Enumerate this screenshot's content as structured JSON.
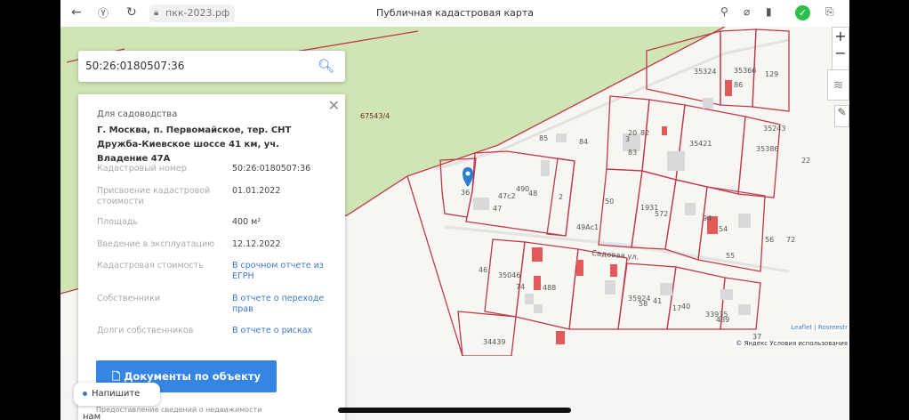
{
  "browser": {
    "url": "пкк-2023.рф",
    "title": "Публичная кадастровая карта"
  },
  "search": {
    "value": "50:26:0180507:36"
  },
  "panel": {
    "purpose": "Для садоводства",
    "address": "Г. Москва, п. Первомайское, тер. СНТ Дружба-Киевское шоссе 41 км, уч. Владение 47А",
    "rows": [
      {
        "key": "Кадастровый номер",
        "value": "50:26:0180507:36",
        "link": false
      },
      {
        "key": "Присвоение кадастровой стоимости",
        "value": "01.01.2022",
        "link": false
      },
      {
        "key": "Площадь",
        "value": "400 м²",
        "link": false
      },
      {
        "key": "Введение в эксплуатацию",
        "value": "12.12.2022",
        "link": false
      },
      {
        "key": "Кадастровая стоимость",
        "value": "В срочном отчете из ЕГРН",
        "link": true
      },
      {
        "key": "Собственники",
        "value": "В отчете о переходе прав",
        "link": true
      },
      {
        "key": "Долги собственников",
        "value": "В отчете о рисках",
        "link": true
      }
    ],
    "docs_button": "Документы по объекту",
    "footnote": "Предоставление сведений о недвижимости"
  },
  "chat": {
    "label": "Напишите нам"
  },
  "map": {
    "street": "Садовая ул.",
    "parcel_labels": [
      "67543/4",
      "36",
      "47",
      "47с2",
      "490",
      "48",
      "2",
      "49Ас1",
      "85",
      "84",
      "50",
      "20",
      "83",
      "82",
      "3",
      "35421",
      "35386",
      "35243",
      "35324",
      "35366",
      "86",
      "129",
      "1931",
      "572",
      "94",
      "54",
      "55",
      "72",
      "56",
      "46",
      "35046",
      "74",
      "488",
      "35924",
      "58",
      "41",
      "17",
      "40",
      "33935",
      "489",
      "34439",
      "37",
      "22"
    ],
    "attribution_leaflet": "Leaflet | Rosreestr",
    "attribution_yandex": "© Яндекс Условия использования",
    "colors": {
      "forest": "#cfe5b4",
      "parcel_border": "#c0394b",
      "building": "#d9d9d9",
      "building_red": "#e05a5a",
      "marker": "#2a7fd4"
    }
  }
}
